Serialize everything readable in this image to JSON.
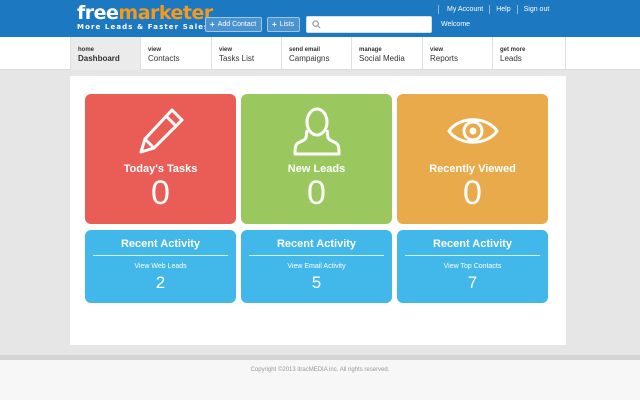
{
  "header": {
    "logo_free": "free",
    "logo_market": "marketer",
    "tagline": "More Leads & Faster Sales",
    "add_contact": "Add Contact",
    "lists": "Lists",
    "search_placeholder": "",
    "links": [
      "My Account",
      "Help",
      "Sign out"
    ],
    "welcome": "Welcome"
  },
  "tabs": [
    {
      "small": "home",
      "main": "Dashboard"
    },
    {
      "small": "view",
      "main": "Contacts"
    },
    {
      "small": "view",
      "main": "Tasks List"
    },
    {
      "small": "send email",
      "main": "Campaigns"
    },
    {
      "small": "manage",
      "main": "Social Media"
    },
    {
      "small": "view",
      "main": "Reports"
    },
    {
      "small": "get more",
      "main": "Leads"
    }
  ],
  "tiles": [
    {
      "title": "Today's Tasks",
      "value": "0",
      "icon": "pencil-icon",
      "color": "#e95d56"
    },
    {
      "title": "New Leads",
      "value": "0",
      "icon": "person-icon",
      "color": "#9ac85f"
    },
    {
      "title": "Recently Viewed",
      "value": "0",
      "icon": "eye-icon",
      "color": "#e8aa4a"
    }
  ],
  "activity": [
    {
      "title": "Recent Activity",
      "link": "View Web Leads",
      "value": "2"
    },
    {
      "title": "Recent Activity",
      "link": "View Email Activity",
      "value": "5"
    },
    {
      "title": "Recent Activity",
      "link": "View Top Contacts",
      "value": "7"
    }
  ],
  "footer": {
    "copyright": "Copyright ©2013 itracMEDIA inc. All rights reserved."
  },
  "colors": {
    "header": "#1c78c0",
    "accent": "#f39a1e",
    "activity": "#42b7ea"
  }
}
